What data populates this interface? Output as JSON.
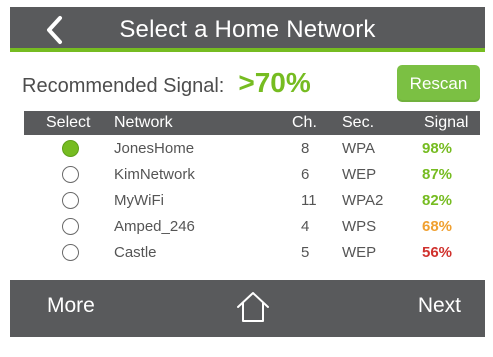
{
  "header": {
    "title": "Select a Home Network",
    "back_icon": "chevron-left-icon"
  },
  "recommended": {
    "label": "Recommended Signal:",
    "value": ">70%"
  },
  "rescan_label": "Rescan",
  "table": {
    "columns": {
      "select": "Select",
      "network": "Network",
      "channel": "Ch.",
      "security": "Sec.",
      "signal": "Signal"
    },
    "rows": [
      {
        "selected": true,
        "network": "JonesHome",
        "channel": "8",
        "security": "WPA",
        "signal": "98%",
        "signal_color": "#76bc21"
      },
      {
        "selected": false,
        "network": "KimNetwork",
        "channel": "6",
        "security": "WEP",
        "signal": "87%",
        "signal_color": "#76bc21"
      },
      {
        "selected": false,
        "network": "MyWiFi",
        "channel": "11",
        "security": "WPA2",
        "signal": "82%",
        "signal_color": "#76bc21"
      },
      {
        "selected": false,
        "network": "Amped_246",
        "channel": "4",
        "security": "WPS",
        "signal": "68%",
        "signal_color": "#f0a030"
      },
      {
        "selected": false,
        "network": "Castle",
        "channel": "5",
        "security": "WEP",
        "signal": "56%",
        "signal_color": "#d0312d"
      }
    ]
  },
  "footer": {
    "more_label": "More",
    "next_label": "Next",
    "home_icon": "home-icon"
  },
  "colors": {
    "accent": "#76bc21",
    "bar": "#595a5c",
    "warning": "#f0a030",
    "danger": "#d0312d"
  }
}
